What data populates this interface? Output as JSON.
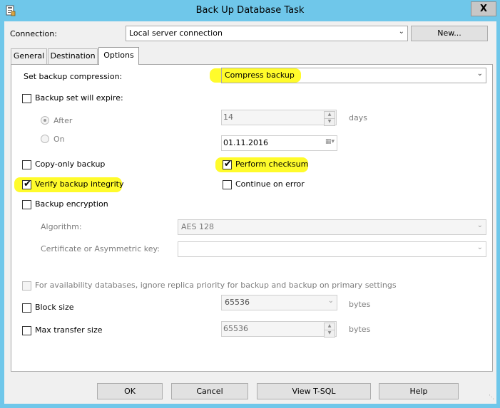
{
  "window": {
    "title": "Back Up Database Task",
    "close_glyph": "X"
  },
  "connection": {
    "label": "Connection:",
    "value": "Local server connection",
    "new_button": "New..."
  },
  "tabs": [
    {
      "label": "General",
      "active": false
    },
    {
      "label": "Destination",
      "active": false
    },
    {
      "label": "Options",
      "active": true
    }
  ],
  "options": {
    "compression_label": "Set backup compression:",
    "compression_value": "Compress backup",
    "expire_label": "Backup set will expire:",
    "expire_checked": false,
    "after_label": "After",
    "after_selected": true,
    "after_value": "14",
    "days_label": "days",
    "on_label": "On",
    "on_selected": false,
    "on_date": "01.11.2016",
    "copy_only_label": "Copy-only backup",
    "copy_only_checked": false,
    "perform_checksum_label": "Perform checksum",
    "perform_checksum_checked": true,
    "verify_label": "Verify backup integrity",
    "verify_checked": true,
    "continue_on_error_label": "Continue on error",
    "continue_on_error_checked": false,
    "encryption_label": "Backup encryption",
    "encryption_checked": false,
    "algorithm_label": "Algorithm:",
    "algorithm_value": "AES 128",
    "certificate_label": "Certificate or Asymmetric key:",
    "certificate_value": "",
    "availability_label": "For availability databases, ignore replica priority for backup and backup on primary settings",
    "availability_checked": false,
    "block_size_label": "Block size",
    "block_size_checked": false,
    "block_size_value": "65536",
    "block_bytes_label": "bytes",
    "max_transfer_label": "Max transfer size",
    "max_transfer_checked": false,
    "max_transfer_value": "65536",
    "max_bytes_label": "bytes"
  },
  "footer": {
    "ok": "OK",
    "cancel": "Cancel",
    "view_tsql": "View T-SQL",
    "help": "Help"
  },
  "colors": {
    "titlebar": "#6fc7ea",
    "highlight": "#fffb2b",
    "dialog_bg": "#f0f0f0"
  }
}
